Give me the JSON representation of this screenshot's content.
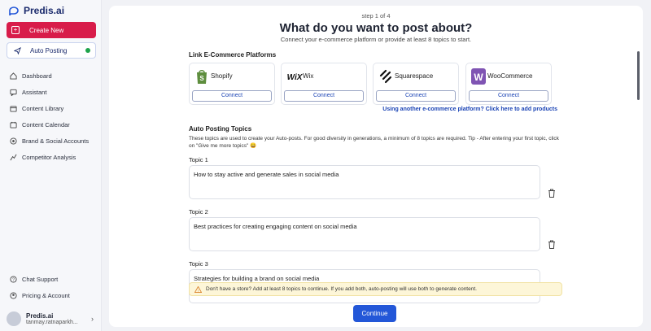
{
  "app": {
    "name": "Predis.ai",
    "brand_color": "#1a2a6c",
    "accent": "#d81c4a"
  },
  "sidebar": {
    "create_new": "Create New",
    "auto_posting": "Auto Posting",
    "items": [
      {
        "label": "Dashboard",
        "icon": "home-icon"
      },
      {
        "label": "Assistant",
        "icon": "chat-icon"
      },
      {
        "label": "Content Library",
        "icon": "library-icon"
      },
      {
        "label": "Content Calendar",
        "icon": "calendar-icon"
      },
      {
        "label": "Brand & Social Accounts",
        "icon": "brand-icon"
      },
      {
        "label": "Competitor Analysis",
        "icon": "chart-icon"
      }
    ],
    "bottom_items": [
      {
        "label": "Chat Support",
        "icon": "help-icon"
      },
      {
        "label": "Pricing & Account",
        "icon": "account-icon"
      }
    ],
    "user": {
      "name": "Predis.ai",
      "email": "tanmay.ratnaparkh..."
    }
  },
  "main": {
    "step": "step 1 of 4",
    "title": "What do you want to post about?",
    "subtitle": "Connect your e-commerce platform or provide at least 8 topics to start.",
    "platforms_heading": "Link E-Commerce Platforms",
    "platforms": [
      {
        "name": "Shopify",
        "button": "Connect"
      },
      {
        "name": "Wix",
        "button": "Connect"
      },
      {
        "name": "Squarespace",
        "button": "Connect"
      },
      {
        "name": "WooCommerce",
        "button": "Connect"
      }
    ],
    "other_platform_link": "Using another e-commerce platform? Click here to add products",
    "topics_heading": "Auto Posting Topics",
    "topics_desc": "These topics are used to create your Auto-posts. For good diversity in generations, a minimum of 8 topics are required. Tip - After entering your first topic, click on \"Give me more topics\" 😀",
    "topics": [
      {
        "label": "Topic 1",
        "value": "How to stay active and generate sales in social media"
      },
      {
        "label": "Topic 2",
        "value": "Best practices for creating engaging content on social media"
      },
      {
        "label": "Topic 3",
        "value": "Strategies for building a brand on social media"
      }
    ],
    "warning": "Don't have a store? Add at least 8 topics to continue. If you add both, auto-posting will use both to generate content.",
    "continue": "Continue"
  }
}
